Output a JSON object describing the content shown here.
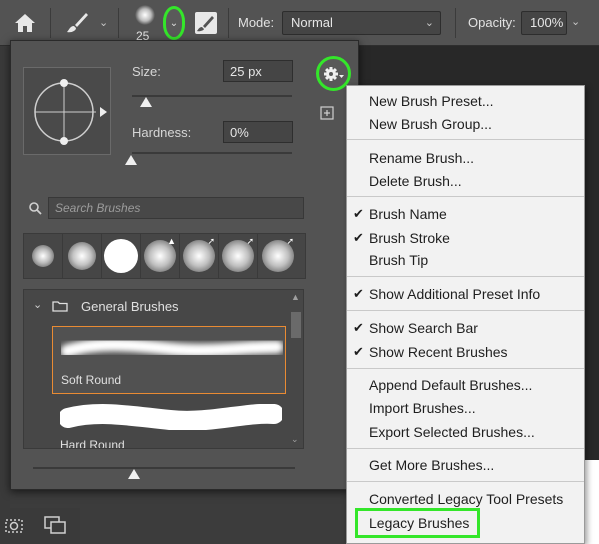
{
  "options_bar": {
    "brush_size": "25",
    "mode_label": "Mode:",
    "mode_value": "Normal",
    "opacity_label": "Opacity:",
    "opacity_value": "100%"
  },
  "picker": {
    "size_label": "Size:",
    "size_value": "25 px",
    "size_level": 0.09,
    "hardness_label": "Hardness:",
    "hardness_value": "0%",
    "search_placeholder": "Search Brushes",
    "group_label": "General Brushes",
    "brushes": [
      {
        "label": "Soft Round",
        "selected": true
      },
      {
        "label": "Hard Round",
        "selected": false
      }
    ],
    "icons": {
      "gear": "gear-icon",
      "new_preset": "plus-square-icon",
      "search": "search-icon",
      "folder": "folder-icon"
    }
  },
  "menu": {
    "items": [
      {
        "label": "New Brush Preset...",
        "checked": false
      },
      {
        "label": "New Brush Group...",
        "checked": false
      },
      {
        "label": "Rename Brush...",
        "checked": false
      },
      {
        "label": "Delete Brush...",
        "checked": false
      },
      {
        "label": "Brush Name",
        "checked": true
      },
      {
        "label": "Brush Stroke",
        "checked": true
      },
      {
        "label": "Brush Tip",
        "checked": false
      },
      {
        "label": "Show Additional Preset Info",
        "checked": true
      },
      {
        "label": "Show Search Bar",
        "checked": true
      },
      {
        "label": "Show Recent Brushes",
        "checked": true
      },
      {
        "label": "Append Default Brushes...",
        "checked": false
      },
      {
        "label": "Import Brushes...",
        "checked": false
      },
      {
        "label": "Export Selected Brushes...",
        "checked": false
      },
      {
        "label": "Get More Brushes...",
        "checked": false
      },
      {
        "label": "Converted Legacy Tool Presets",
        "checked": false
      },
      {
        "label": "Legacy Brushes",
        "checked": false
      }
    ]
  },
  "colors": {
    "highlight_green": "#34e62a",
    "selected_orange": "#e98b33",
    "panel_bg": "#535353",
    "menu_bg": "#f2f2f2"
  }
}
